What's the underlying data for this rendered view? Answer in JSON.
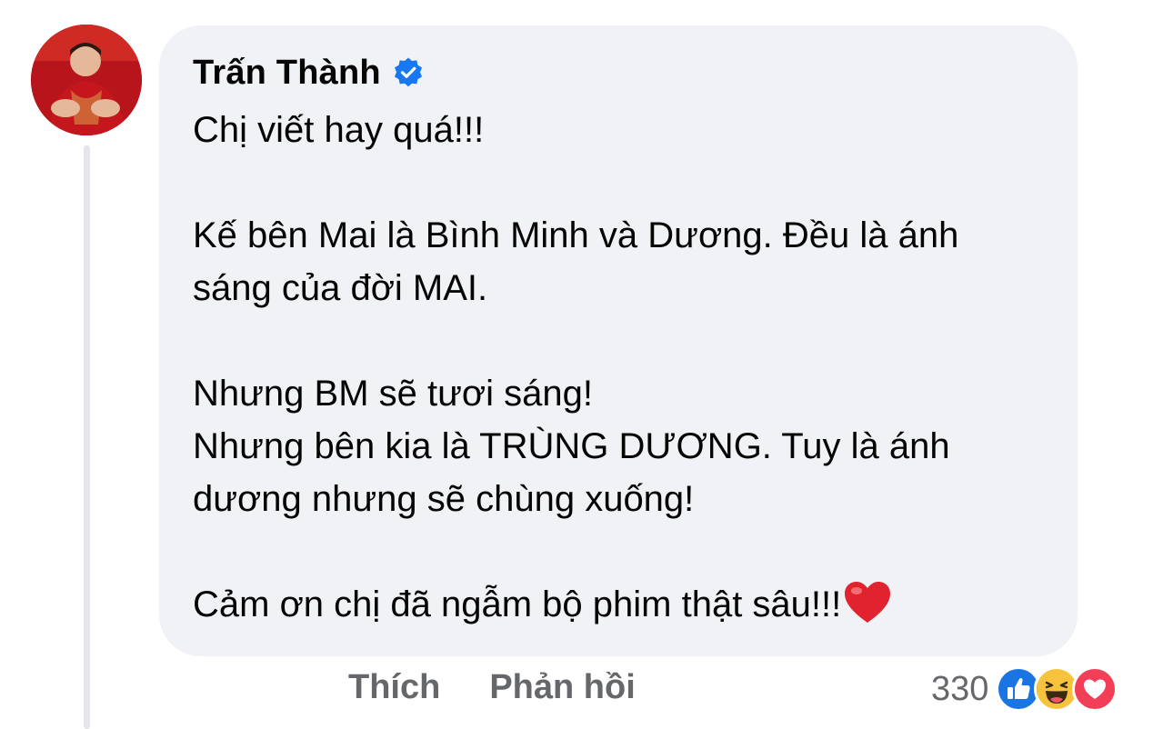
{
  "comment": {
    "author": "Trấn Thành",
    "verified_icon": "verified-badge-icon",
    "lines": [
      "Chị viết hay quá!!!",
      "",
      "Kế bên Mai là Bình Minh và Dương. Đều là ánh",
      "sáng của đời MAI.",
      "",
      "Nhưng BM sẽ tươi sáng!",
      "Nhưng bên kia là TRÙNG DƯƠNG. Tuy là ánh",
      "dương nhưng sẽ chùng xuống!",
      "",
      "Cảm ơn chị đã ngẫm bộ phim thật sâu!!!"
    ],
    "trailing_emoji": "heart-emoji"
  },
  "actions": {
    "like_label": "Thích",
    "reply_label": "Phản hồi"
  },
  "reactions": {
    "count": "330",
    "types": [
      "like-reaction-icon",
      "haha-reaction-icon",
      "love-reaction-icon"
    ]
  },
  "colors": {
    "bubble_bg": "#f0f2f5",
    "text": "#050505",
    "secondary_text": "#65676b",
    "verified_blue": "#1877f2",
    "love_red": "#f33e58"
  }
}
